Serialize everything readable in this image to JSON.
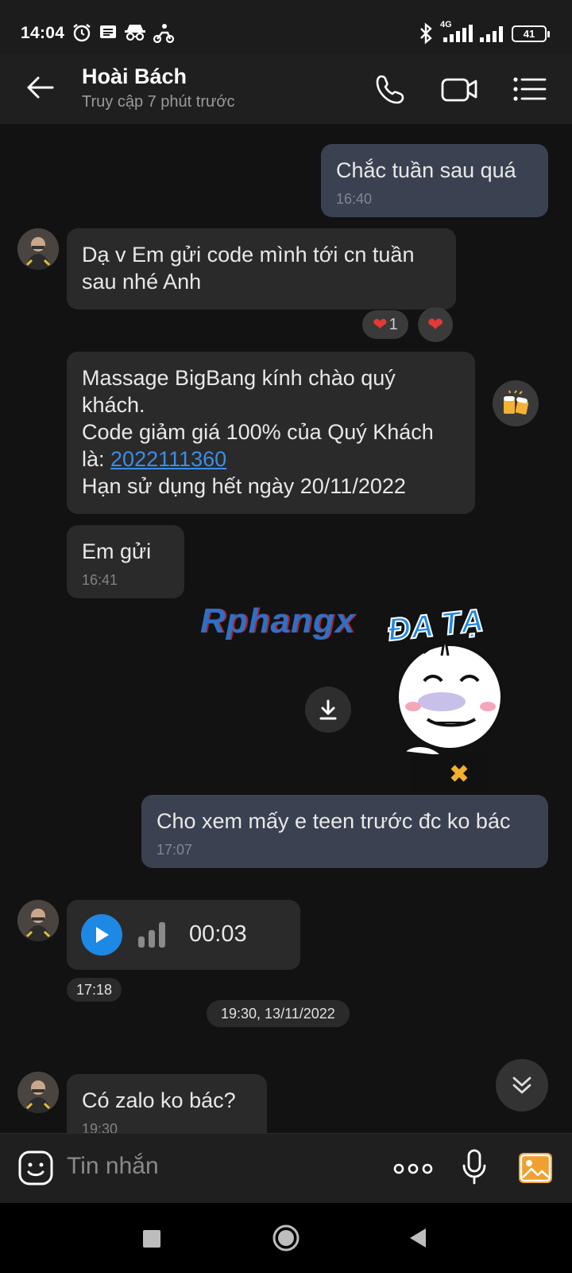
{
  "status_bar": {
    "time": "14:04",
    "network": "4G",
    "battery": "41"
  },
  "header": {
    "contact_name": "Hoài Bách",
    "last_seen": "Truy cập 7 phút trước"
  },
  "messages": {
    "m1": {
      "text": "Chắc tuần sau quá",
      "time": "16:40"
    },
    "m2": {
      "text": "Dạ v Em gửi code mình tới cn tuần sau nhé Anh",
      "reaction_count": "1"
    },
    "m3": {
      "line1": "Massage BigBang kính chào quý khách.",
      "line2_prefix": "Code giảm giá 100% của Quý Khách là: ",
      "code": "2022111360",
      "line3": "Hạn sử dụng hết ngày 20/11/2022"
    },
    "m4": {
      "text": "Em gửi",
      "time": "16:41"
    },
    "sticker": {
      "caption": "ĐA TẠ"
    },
    "m5": {
      "text": "Cho xem mấy e teen trước đc ko bác",
      "time": "17:07"
    },
    "voice": {
      "duration": "00:03",
      "time": "17:18"
    },
    "date_chip": "19:30, 13/11/2022",
    "m6": {
      "text": "Có zalo ko bác?",
      "time": "19:30"
    }
  },
  "watermark": "Rphangx",
  "input": {
    "placeholder": "Tin nhắn"
  },
  "colors": {
    "background": "#121212",
    "outgoing_bubble": "#3a4150",
    "incoming_bubble": "#2a2a2a",
    "link": "#3a8ee6",
    "play_button": "#1e88e5",
    "image_button": "#f0a030"
  }
}
